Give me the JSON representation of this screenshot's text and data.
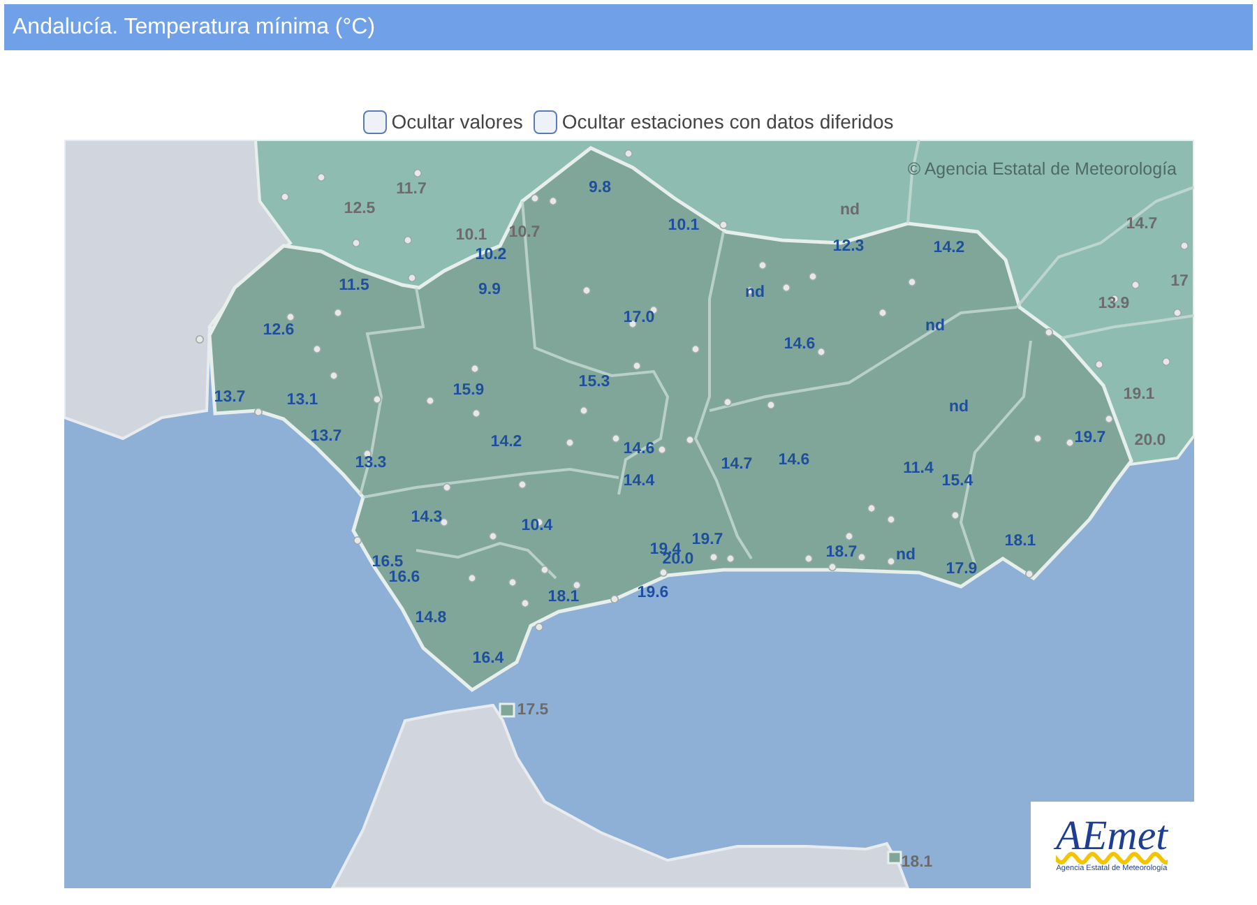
{
  "header": {
    "title": "Andalucía. Temperatura mínima (°C)"
  },
  "options": [
    {
      "label": "Ocultar valores",
      "checked": false
    },
    {
      "label": "Ocultar estaciones con datos diferidos",
      "checked": false
    }
  ],
  "map": {
    "attribution": "© Agencia Estatal de Meteorología",
    "logo": {
      "name": "AEmet",
      "subtitle": "Agencia Estatal de Meteorología"
    },
    "stations": [
      {
        "value": "11.7",
        "kind": "outside"
      },
      {
        "value": "12.5",
        "kind": "outside"
      },
      {
        "value": "9.8",
        "kind": "andalucia"
      },
      {
        "value": "nd",
        "kind": "outside"
      },
      {
        "value": "14.7",
        "kind": "outside"
      },
      {
        "value": "10.1",
        "kind": "andalucia"
      },
      {
        "value": "10.1",
        "kind": "outside"
      },
      {
        "value": "10.7",
        "kind": "outside"
      },
      {
        "value": "12.3",
        "kind": "andalucia"
      },
      {
        "value": "14.2",
        "kind": "andalucia"
      },
      {
        "value": "10.2",
        "kind": "andalucia"
      },
      {
        "value": "17",
        "kind": "outside"
      },
      {
        "value": "11.5",
        "kind": "andalucia"
      },
      {
        "value": "9.9",
        "kind": "andalucia"
      },
      {
        "value": "nd",
        "kind": "andalucia"
      },
      {
        "value": "13.9",
        "kind": "outside"
      },
      {
        "value": "17.0",
        "kind": "andalucia"
      },
      {
        "value": "12.6",
        "kind": "andalucia"
      },
      {
        "value": "nd",
        "kind": "andalucia"
      },
      {
        "value": "14.6",
        "kind": "andalucia"
      },
      {
        "value": "15.3",
        "kind": "andalucia"
      },
      {
        "value": "13.7",
        "kind": "andalucia"
      },
      {
        "value": "13.1",
        "kind": "andalucia"
      },
      {
        "value": "15.9",
        "kind": "andalucia"
      },
      {
        "value": "nd",
        "kind": "andalucia"
      },
      {
        "value": "19.1",
        "kind": "outside"
      },
      {
        "value": "13.7",
        "kind": "andalucia"
      },
      {
        "value": "14.2",
        "kind": "andalucia"
      },
      {
        "value": "14.6",
        "kind": "andalucia"
      },
      {
        "value": "19.7",
        "kind": "andalucia"
      },
      {
        "value": "20.0",
        "kind": "outside"
      },
      {
        "value": "13.3",
        "kind": "andalucia"
      },
      {
        "value": "14.7",
        "kind": "andalucia"
      },
      {
        "value": "14.6",
        "kind": "andalucia"
      },
      {
        "value": "11.4",
        "kind": "andalucia"
      },
      {
        "value": "14.4",
        "kind": "andalucia"
      },
      {
        "value": "15.4",
        "kind": "andalucia"
      },
      {
        "value": "14.3",
        "kind": "andalucia"
      },
      {
        "value": "10.4",
        "kind": "andalucia"
      },
      {
        "value": "16.5",
        "kind": "andalucia"
      },
      {
        "value": "19.4",
        "kind": "andalucia"
      },
      {
        "value": "19.7",
        "kind": "andalucia"
      },
      {
        "value": "20.0",
        "kind": "andalucia"
      },
      {
        "value": "18.7",
        "kind": "andalucia"
      },
      {
        "value": "nd",
        "kind": "andalucia"
      },
      {
        "value": "18.1",
        "kind": "andalucia"
      },
      {
        "value": "16.6",
        "kind": "andalucia"
      },
      {
        "value": "17.9",
        "kind": "andalucia"
      },
      {
        "value": "18.1",
        "kind": "andalucia"
      },
      {
        "value": "19.6",
        "kind": "andalucia"
      },
      {
        "value": "14.8",
        "kind": "andalucia"
      },
      {
        "value": "16.4",
        "kind": "andalucia"
      },
      {
        "value": "17.5",
        "kind": "outside"
      },
      {
        "value": "18.1",
        "kind": "outside"
      }
    ]
  }
}
